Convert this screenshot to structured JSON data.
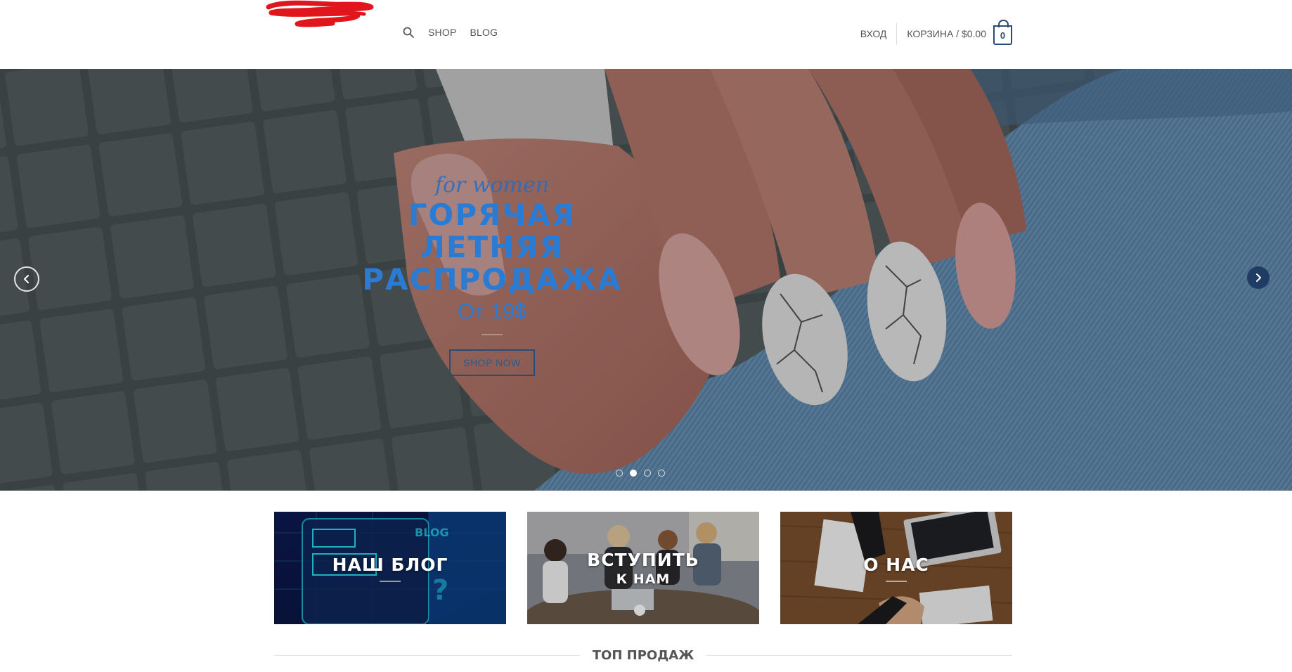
{
  "header": {
    "logo_alt": "logo",
    "nav": [
      {
        "label": "SHOP"
      },
      {
        "label": "BLOG"
      }
    ],
    "search_icon": "search-icon",
    "login_label": "ВХОД",
    "cart_label": "КОРЗИНА / $0.00",
    "cart_count": "0"
  },
  "hero": {
    "script_text": "for women",
    "title_lines": [
      "ГОРЯЧАЯ",
      "ЛЕТНЯЯ",
      "РАСПРОДАЖА"
    ],
    "price": "От 19$",
    "button_label": "SHOP NOW",
    "slide_count": 4,
    "active_slide": 2
  },
  "banners": [
    {
      "title": "НАШ БЛОГ",
      "subtitle": ""
    },
    {
      "title": "ВСТУПИТЬ",
      "subtitle": "К НАМ"
    },
    {
      "title": "О НАС",
      "subtitle": ""
    }
  ],
  "section": {
    "title": "ТОП ПРОДАЖ"
  },
  "colors": {
    "accent": "#2a7bd4",
    "brand_dark": "#2a4b74",
    "logo_scribble": "#e0161c"
  }
}
